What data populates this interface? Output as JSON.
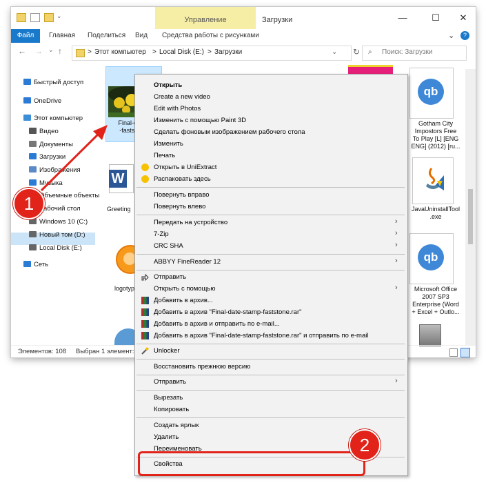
{
  "window": {
    "title": "Загрузки",
    "contextual_tab": "Управление",
    "controls": {
      "minimize": "—",
      "maximize": "☐",
      "close": "✕",
      "expand": "⌄",
      "help": "?"
    }
  },
  "ribbon": {
    "tabs": [
      "Файл",
      "Главная",
      "Поделиться",
      "Вид",
      "Средства работы с рисунками"
    ]
  },
  "address": {
    "back": "←",
    "forward": "→",
    "history": "⌄",
    "up": "↑",
    "path": [
      "Этот компьютер",
      "Local Disk (E:)",
      "Загрузки"
    ],
    "separator": ">",
    "dropdown": "⌄",
    "refresh": "↻",
    "search_placeholder": "Поиск: Загрузки",
    "search_icon": "⌕"
  },
  "nav": {
    "items": [
      {
        "label": "Быстрый доступ",
        "icon": "star-icon",
        "color": "#2b7bd6"
      },
      {
        "label": "OneDrive",
        "icon": "cloud-icon",
        "color": "#2b7bd6"
      },
      {
        "label": "Этот компьютер",
        "icon": "computer-icon",
        "color": "#3c8fd6"
      },
      {
        "label": "Видео",
        "icon": "video-icon",
        "color": "#555555"
      },
      {
        "label": "Документы",
        "icon": "documents-icon",
        "color": "#777777"
      },
      {
        "label": "Загрузки",
        "icon": "download-icon",
        "color": "#2b7bd6"
      },
      {
        "label": "Изображения",
        "icon": "pictures-icon",
        "color": "#5a8ac7"
      },
      {
        "label": "Музыка",
        "icon": "music-icon",
        "color": "#2b7bd6"
      },
      {
        "label": "Объемные объекты",
        "icon": "3d-objects-icon",
        "color": "#4a9ad8"
      },
      {
        "label": "Рабочий стол",
        "icon": "desktop-icon",
        "color": "#3c8fd6"
      },
      {
        "label": "Windows 10 (C:)",
        "icon": "drive-icon",
        "color": "#666666"
      },
      {
        "label": "Новый том (D:)",
        "icon": "drive-icon",
        "color": "#666666"
      },
      {
        "label": "Local Disk (E:)",
        "icon": "drive-icon",
        "color": "#666666"
      },
      {
        "label": "Сеть",
        "icon": "network-icon",
        "color": "#2b7bd6"
      }
    ]
  },
  "files": {
    "selected_file": [
      "Final-date-",
      "-faststone"
    ],
    "word_file": "Greeting",
    "logo_file": "logotyp",
    "gotham": [
      "Gotham City",
      "Impostors Free",
      "To Play [L] [ENG",
      "ENG] (2012) [ru..."
    ],
    "java": [
      "JavaUninstallTool",
      ".exe"
    ],
    "office": [
      "Microsoft Office",
      "2007 SP3",
      "Enterprise (Word",
      "+ Excel + Outlo..."
    ]
  },
  "status": {
    "count": "Элементов: 108",
    "selected": "Выбран 1 элемент: 1"
  },
  "menu": {
    "items": {
      "open": "Открыть",
      "create_video": "Create a new video",
      "edit_photos": "Edit with Photos",
      "paint3d": "Изменить с помощью Paint 3D",
      "wallpaper": "Сделать фоновым изображением рабочего стола",
      "edit": "Изменить",
      "print": "Печать",
      "uniextract_open": "Открыть в UniExtract",
      "uniextract_here": "Распаковать здесь",
      "rotate_right": "Повернуть вправо",
      "rotate_left": "Повернуть влево",
      "cast": "Передать на устройство",
      "zip7": "7-Zip",
      "crc": "CRC SHA",
      "abbyy": "ABBYY FineReader 12",
      "share": "Отправить",
      "open_with": "Открыть с помощью",
      "rar_add": "Добавить в архив...",
      "rar_add_named": "Добавить в архив \"Final-date-stamp-faststone.rar\"",
      "rar_email": "Добавить в архив и отправить по e-mail...",
      "rar_email_named": "Добавить в архив \"Final-date-stamp-faststone.rar\" и отправить по e-mail",
      "unlocker": "Unlocker",
      "restore": "Восстановить прежнюю версию",
      "send_to": "Отправить",
      "cut": "Вырезать",
      "copy": "Копировать",
      "shortcut": "Создать ярлык",
      "delete": "Удалить",
      "rename": "Переименовать",
      "properties": "Свойства"
    },
    "submenu_arrow": "›"
  },
  "callouts": {
    "one": "1",
    "two": "2",
    "color": "#e2231a"
  }
}
